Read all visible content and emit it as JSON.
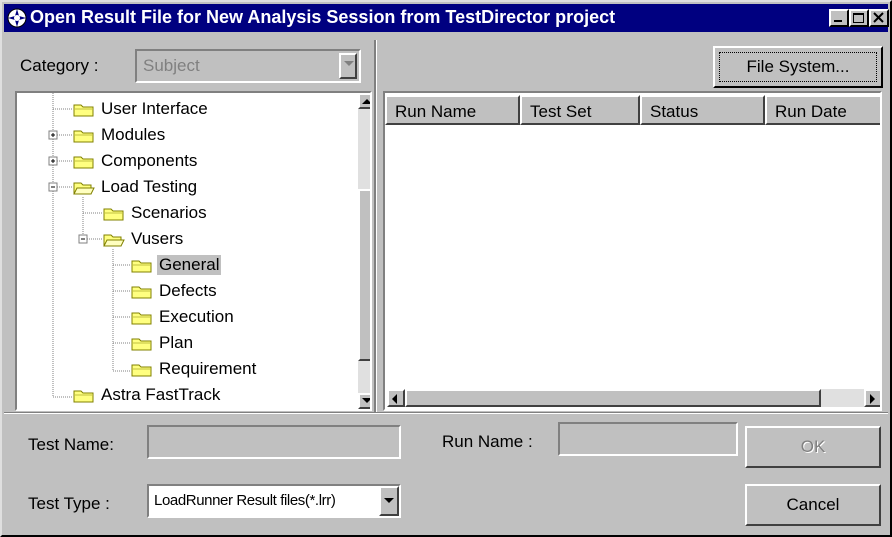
{
  "window": {
    "title": "Open Result File for New Analysis Session from TestDirector project",
    "buttons": [
      "minimize",
      "maximize",
      "close"
    ]
  },
  "category": {
    "label": "Category :",
    "value": "Subject"
  },
  "file_system_button": "File System...",
  "tree": {
    "items": [
      {
        "label": "User Interface",
        "expander": "none",
        "open": false,
        "selected": false
      },
      {
        "label": "Modules",
        "expander": "plus",
        "open": false,
        "selected": false
      },
      {
        "label": "Components",
        "expander": "plus",
        "open": false,
        "selected": false
      },
      {
        "label": "Load Testing",
        "expander": "minus",
        "open": true,
        "selected": false
      },
      {
        "label": "Scenarios",
        "expander": "none",
        "open": false,
        "selected": false
      },
      {
        "label": "Vusers",
        "expander": "minus",
        "open": true,
        "selected": false
      },
      {
        "label": "General",
        "expander": "none",
        "open": false,
        "selected": true
      },
      {
        "label": "Defects",
        "expander": "none",
        "open": false,
        "selected": false
      },
      {
        "label": "Execution",
        "expander": "none",
        "open": false,
        "selected": false
      },
      {
        "label": "Plan",
        "expander": "none",
        "open": false,
        "selected": false
      },
      {
        "label": "Requirement",
        "expander": "none",
        "open": false,
        "selected": false
      },
      {
        "label": "Astra FastTrack",
        "expander": "none",
        "open": false,
        "selected": false
      }
    ]
  },
  "results_table": {
    "columns": [
      "Run Name",
      "Test Set",
      "Status",
      "Run Date"
    ],
    "rows": []
  },
  "test_name": {
    "label": "Test Name:",
    "value": ""
  },
  "run_name": {
    "label": "Run Name :",
    "value": ""
  },
  "test_type": {
    "label": "Test Type :",
    "value": "LoadRunner Result files(*.lrr)"
  },
  "ok_button": "OK",
  "cancel_button": "Cancel",
  "colors": {
    "title_bar": "#000080",
    "face": "#c0c0c0",
    "folder": "#ffff80"
  }
}
